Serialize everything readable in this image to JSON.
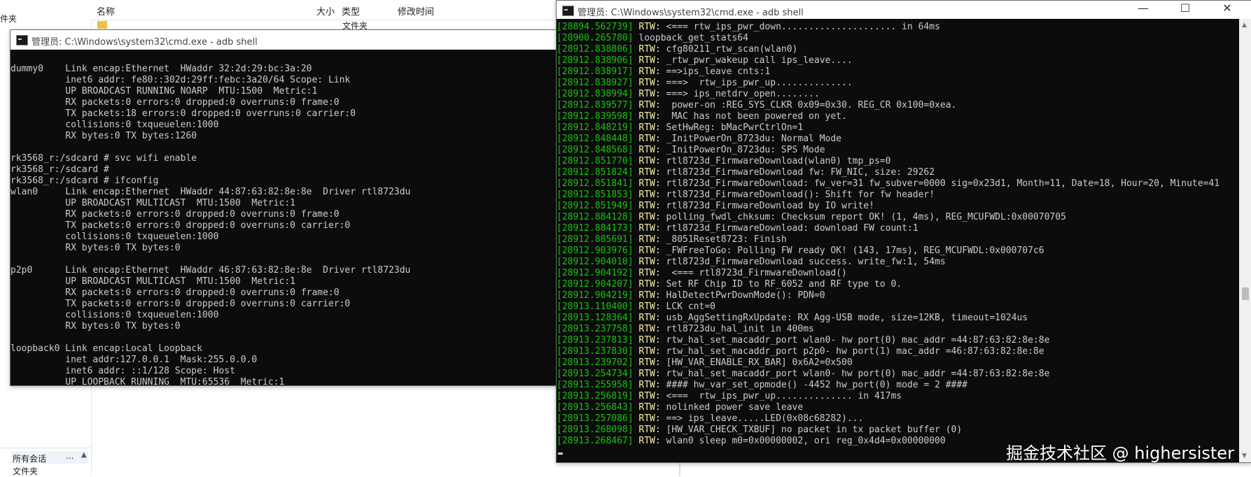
{
  "explorer": {
    "left_label": "件夹",
    "columns": {
      "name": "名称",
      "size": "大小",
      "type": "类型",
      "modified": "修改时间"
    },
    "folder_row_type": "文件夹",
    "bottom": {
      "selected": "所有会话",
      "more": "...",
      "up": "▲",
      "folder": "文件夹"
    }
  },
  "cmd1": {
    "title": "管理员: C:\\Windows\\system32\\cmd.exe - adb  shell",
    "lines": [
      "",
      "dummy0    Link encap:Ethernet  HWaddr 32:2d:29:bc:3a:20",
      "          inet6 addr: fe80::302d:29ff:febc:3a20/64 Scope: Link",
      "          UP BROADCAST RUNNING NOARP  MTU:1500  Metric:1",
      "          RX packets:0 errors:0 dropped:0 overruns:0 frame:0",
      "          TX packets:18 errors:0 dropped:0 overruns:0 carrier:0",
      "          collisions:0 txqueuelen:1000",
      "          RX bytes:0 TX bytes:1260",
      "",
      "rk3568_r:/sdcard # svc wifi enable",
      "rk3568_r:/sdcard #",
      "rk3568_r:/sdcard # ifconfig",
      "wlan0     Link encap:Ethernet  HWaddr 44:87:63:82:8e:8e  Driver rtl8723du",
      "          UP BROADCAST MULTICAST  MTU:1500  Metric:1",
      "          RX packets:0 errors:0 dropped:0 overruns:0 frame:0",
      "          TX packets:0 errors:0 dropped:0 overruns:0 carrier:0",
      "          collisions:0 txqueuelen:1000",
      "          RX bytes:0 TX bytes:0",
      "",
      "p2p0      Link encap:Ethernet  HWaddr 46:87:63:82:8e:8e  Driver rtl8723du",
      "          UP BROADCAST MULTICAST  MTU:1500  Metric:1",
      "          RX packets:0 errors:0 dropped:0 overruns:0 frame:0",
      "          TX packets:0 errors:0 dropped:0 overruns:0 carrier:0",
      "          collisions:0 txqueuelen:1000",
      "          RX bytes:0 TX bytes:0",
      "",
      "loopback0 Link encap:Local Loopback",
      "          inet addr:127.0.0.1  Mask:255.0.0.0",
      "          inet6 addr: ::1/128 Scope: Host",
      "          UP LOOPBACK RUNNING  MTU:65536  Metric:1"
    ]
  },
  "cmd2": {
    "title": "管理员: C:\\Windows\\system32\\cmd.exe - adb  shell",
    "buttons": {
      "minimize": "—",
      "maximize": "☐",
      "close": "✕"
    },
    "log": [
      {
        "ts": "[28894.562739]",
        "tag": "RTW:",
        "msg": " <=== rtw_ips_pwr_down..................... in 64ms"
      },
      {
        "ts": "[28900.265780]",
        "tag": "",
        "msg": "loopback_get_stats64"
      },
      {
        "ts": "[28912.838806]",
        "tag": "RTW:",
        "msg": " cfg80211_rtw_scan(wlan0)"
      },
      {
        "ts": "[28912.838906]",
        "tag": "RTW:",
        "msg": " _rtw_pwr_wakeup call ips_leave...."
      },
      {
        "ts": "[28912.838917]",
        "tag": "RTW:",
        "msg": " ==>ips_leave cnts:1"
      },
      {
        "ts": "[28912.838927]",
        "tag": "RTW:",
        "msg": " ===>  rtw_ips_pwr_up.............."
      },
      {
        "ts": "[28912.838994]",
        "tag": "RTW:",
        "msg": " ===> ips_netdrv_open........"
      },
      {
        "ts": "[28912.839577]",
        "tag": "RTW:",
        "msg": "  power-on :REG_SYS_CLKR 0x09=0x30. REG_CR 0x100=0xea."
      },
      {
        "ts": "[28912.839598]",
        "tag": "RTW:",
        "msg": "  MAC has not been powered on yet."
      },
      {
        "ts": "[28912.848219]",
        "tag": "RTW:",
        "msg": " SetHwReg: bMacPwrCtrlOn=1"
      },
      {
        "ts": "[28912.848448]",
        "tag": "RTW:",
        "msg": " _InitPowerOn_8723du: Normal Mode"
      },
      {
        "ts": "[28912.848568]",
        "tag": "RTW:",
        "msg": " _InitPowerOn_8723du: SPS Mode"
      },
      {
        "ts": "[28912.851770]",
        "tag": "RTW:",
        "msg": " rtl8723d_FirmwareDownload(wlan0) tmp_ps=0"
      },
      {
        "ts": "[28912.851824]",
        "tag": "RTW:",
        "msg": " rtl8723d_FirmwareDownload fw: FW_NIC, size: 29262"
      },
      {
        "ts": "[28912.851841]",
        "tag": "RTW:",
        "msg": " rtl8723d_FirmwareDownload: fw_ver=31 fw_subver=0000 sig=0x23d1, Month=11, Date=18, Hour=20, Minute=41"
      },
      {
        "ts": "[28912.851853]",
        "tag": "RTW:",
        "msg": " rtl8723d_FirmwareDownload(): Shift for fw header!"
      },
      {
        "ts": "[28912.851949]",
        "tag": "RTW:",
        "msg": " rtl8723d_FirmwareDownload by IO write!"
      },
      {
        "ts": "[28912.884128]",
        "tag": "RTW:",
        "msg": " polling_fwdl_chksum: Checksum report OK! (1, 4ms), REG_MCUFWDL:0x00070705"
      },
      {
        "ts": "[28912.884173]",
        "tag": "RTW:",
        "msg": " rtl8723d_FirmwareDownload: download FW count:1"
      },
      {
        "ts": "[28912.885691]",
        "tag": "RTW:",
        "msg": " _8051Reset8723: Finish"
      },
      {
        "ts": "[28912.903976]",
        "tag": "RTW:",
        "msg": " _FWFreeToGo: Polling FW ready OK! (143, 17ms), REG_MCUFWDL:0x000707c6"
      },
      {
        "ts": "[28912.904010]",
        "tag": "RTW:",
        "msg": " rtl8723d_FirmwareDownload success. write_fw:1, 54ms"
      },
      {
        "ts": "[28912.904192]",
        "tag": "RTW:",
        "msg": "  <=== rtl8723d_FirmwareDownload()"
      },
      {
        "ts": "[28912.904207]",
        "tag": "RTW:",
        "msg": " Set RF Chip ID to RF_6052 and RF type to 0."
      },
      {
        "ts": "[28912.904219]",
        "tag": "RTW:",
        "msg": " HalDetectPwrDownMode(): PDN=0"
      },
      {
        "ts": "[28913.110400]",
        "tag": "RTW:",
        "msg": " LCK cnt=0"
      },
      {
        "ts": "[28913.128364]",
        "tag": "RTW:",
        "msg": " usb_AggSettingRxUpdate: RX Agg-USB mode, size=12KB, timeout=1024us"
      },
      {
        "ts": "[28913.237758]",
        "tag": "RTW:",
        "msg": " rtl8723du_hal_init in 400ms"
      },
      {
        "ts": "[28913.237813]",
        "tag": "RTW:",
        "msg": " rtw_hal_set_macaddr_port wlan0- hw port(0) mac_addr =44:87:63:82:8e:8e"
      },
      {
        "ts": "[28913.237830]",
        "tag": "RTW:",
        "msg": " rtw_hal_set_macaddr_port p2p0- hw port(1) mac_addr =46:87:63:82:8e:8e"
      },
      {
        "ts": "[28913.239702]",
        "tag": "RTW:",
        "msg": " [HW_VAR_ENABLE_RX_BAR] 0x6A2=0x500"
      },
      {
        "ts": "[28913.254734]",
        "tag": "RTW:",
        "msg": " rtw_hal_set_macaddr_port wlan0- hw port(0) mac_addr =44:87:63:82:8e:8e"
      },
      {
        "ts": "[28913.255958]",
        "tag": "RTW:",
        "msg": " #### hw_var_set_opmode() -4452 hw_port(0) mode = 2 ####"
      },
      {
        "ts": "[28913.256819]",
        "tag": "RTW:",
        "msg": " <===  rtw_ips_pwr_up.............. in 417ms"
      },
      {
        "ts": "[28913.256843]",
        "tag": "RTW:",
        "msg": " nolinked power save leave"
      },
      {
        "ts": "[28913.257086]",
        "tag": "RTW:",
        "msg": " ==> ips_leave.....LED(0x08c68282)..."
      },
      {
        "ts": "[28913.268098]",
        "tag": "RTW:",
        "msg": " [HW_VAR_CHECK_TXBUF] no packet in tx packet buffer (0)"
      },
      {
        "ts": "[28913.268467]",
        "tag": "RTW:",
        "msg": " wlan0 sleep m0=0x00000002, ori reg_0x4d4=0x00000000"
      }
    ]
  },
  "watermark": "掘金技术社区 @ highersister",
  "colors": {
    "console_bg": "#0c0c0c",
    "console_text": "#cccccc",
    "timestamp": "#16c60c",
    "tag": "#f9f1a5"
  }
}
